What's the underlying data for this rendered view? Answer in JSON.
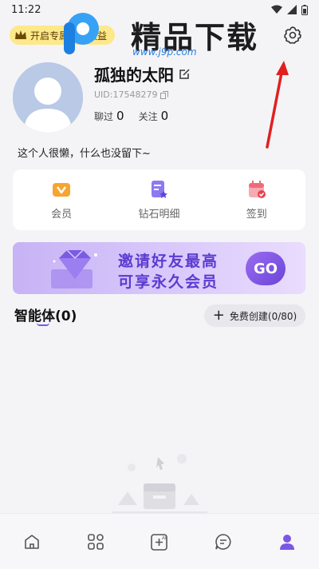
{
  "status_bar": {
    "time": "11:22"
  },
  "header": {
    "vip_pill_label": "开启专属会员权益",
    "watermark_title": "精品下载",
    "watermark_url": "www.j9p.com"
  },
  "profile": {
    "username": "孤独的太阳",
    "uid": "UID:17548279",
    "chats_label": "聊过",
    "chats_count": "0",
    "following_label": "关注",
    "following_count": "0",
    "bio": "这个人很懒，什么也没留下~"
  },
  "quick_actions": [
    {
      "label": "会员",
      "icon": "vip-icon"
    },
    {
      "label": "钻石明细",
      "icon": "diamond-detail-icon"
    },
    {
      "label": "签到",
      "icon": "checkin-calendar-icon"
    }
  ],
  "banner": {
    "line1": "邀请好友最高",
    "line2": "可享永久会员",
    "go_label": "GO"
  },
  "agents": {
    "title": "智能体(0)",
    "create_label": "免费创建(0/80)"
  },
  "tabbar": {
    "items": [
      {
        "icon": "home-icon"
      },
      {
        "icon": "discover-grid-icon"
      },
      {
        "icon": "ai-create-icon"
      },
      {
        "icon": "chat-icon"
      },
      {
        "icon": "profile-icon",
        "active": true
      }
    ]
  },
  "colors": {
    "accent": "#7b57e6",
    "vip_pill": "#fde88a",
    "annotation_arrow": "#e02020"
  }
}
